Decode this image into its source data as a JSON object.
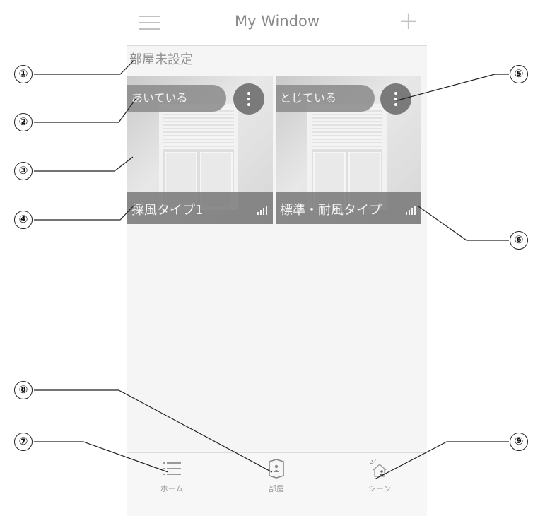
{
  "header": {
    "title": "My Window"
  },
  "room": {
    "label": "部屋未設定"
  },
  "windows": [
    {
      "status": "あいている",
      "name": "採風タイプ1"
    },
    {
      "status": "とじている",
      "name": "標準・耐風タイプ"
    }
  ],
  "tabs": [
    {
      "label": "ホーム",
      "icon": "list-icon"
    },
    {
      "label": "部屋",
      "icon": "room-icon"
    },
    {
      "label": "シーン",
      "icon": "scene-icon"
    }
  ],
  "callouts": {
    "c1": "①",
    "c2": "②",
    "c3": "③",
    "c4": "④",
    "c5": "⑤",
    "c6": "⑥",
    "c7": "⑦",
    "c8": "⑧",
    "c9": "⑨"
  },
  "colors": {
    "background": "#f5f5f5",
    "card_overlay": "#6e6e6e",
    "menu_button": "#7a7a7a"
  }
}
